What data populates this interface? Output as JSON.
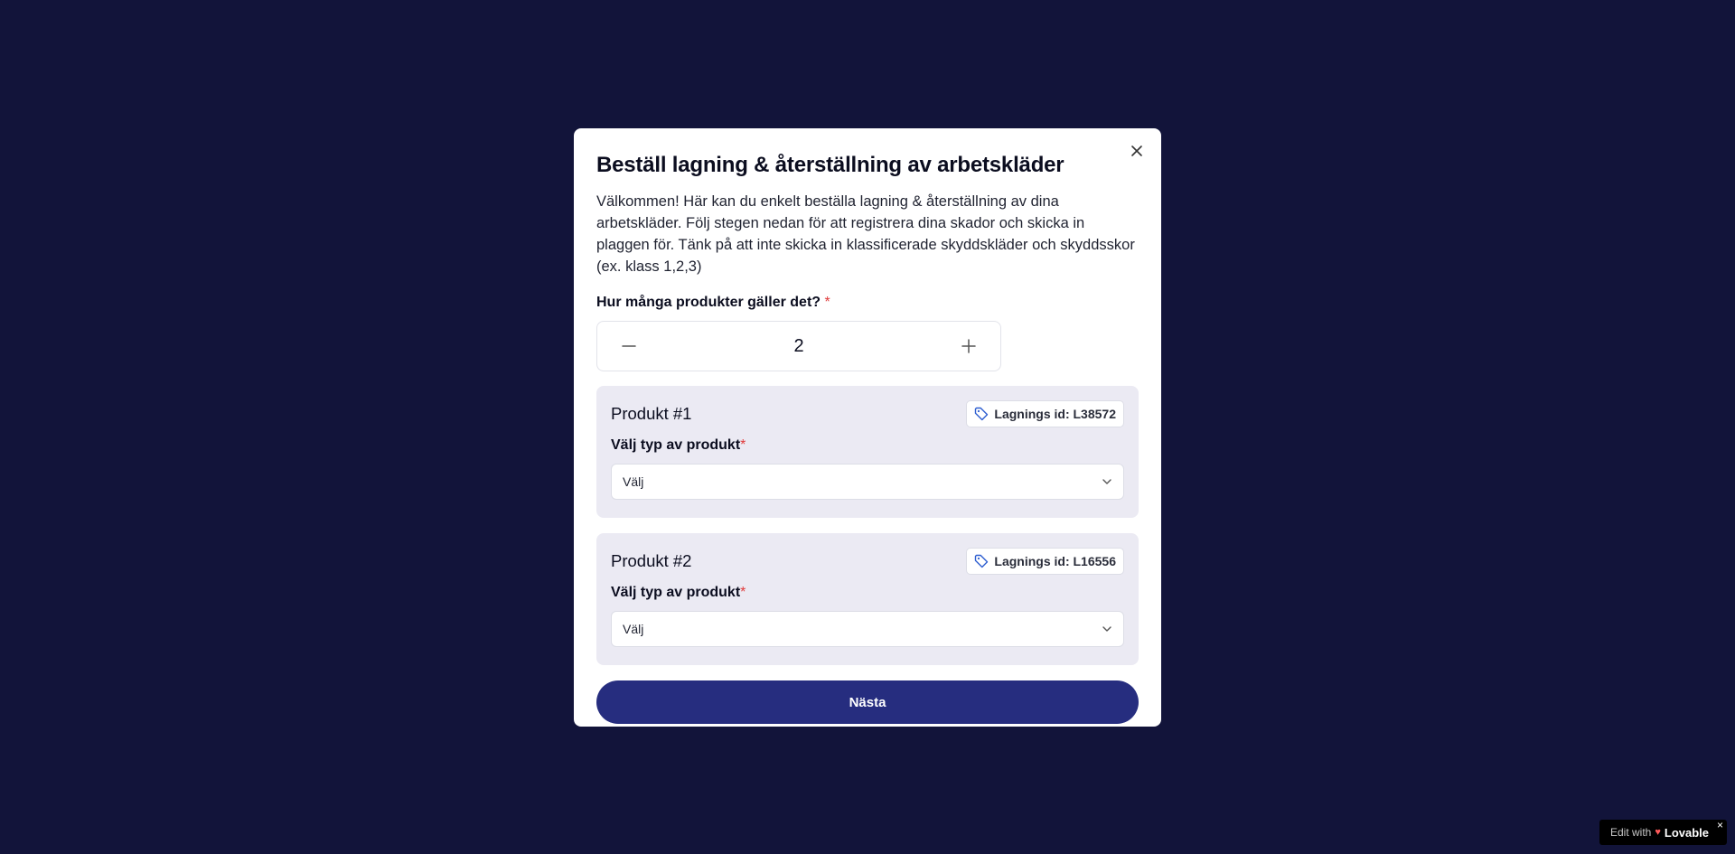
{
  "modal": {
    "title": "Beställ lagning & återställning av arbetskläder",
    "intro": "Välkommen! Här kan du enkelt beställa lagning & återställning av dina arbetskläder. Följ stegen nedan för att registrera dina skador och skicka in plaggen för. Tänk på att inte skicka in klassificerade skyddskläder och skyddsskor (ex. klass 1,2,3)",
    "quantity_label": "Hur många produkter gäller det?",
    "required_mark": "*",
    "quantity_value": "2",
    "products": [
      {
        "title": "Produkt #1",
        "id_text": "Lagnings id: L38572",
        "type_label": "Välj typ av produkt",
        "select_value": "Välj"
      },
      {
        "title": "Produkt #2",
        "id_text": "Lagnings id: L16556",
        "type_label": "Välj typ av produkt",
        "select_value": "Välj"
      }
    ],
    "next_label": "Nästa"
  },
  "badge": {
    "prefix": "Edit with",
    "brand": "Lovable",
    "close": "×"
  },
  "icons": {
    "close": "close-icon",
    "minus": "minus-icon",
    "plus": "plus-icon",
    "tag": "tag-icon",
    "chevron": "chevron-down-icon"
  },
  "colors": {
    "background": "#12143a",
    "primary_button": "#262d7f",
    "product_card": "#ebeaf3",
    "required": "#e03b3b",
    "tag_icon": "#2f5fd0"
  }
}
